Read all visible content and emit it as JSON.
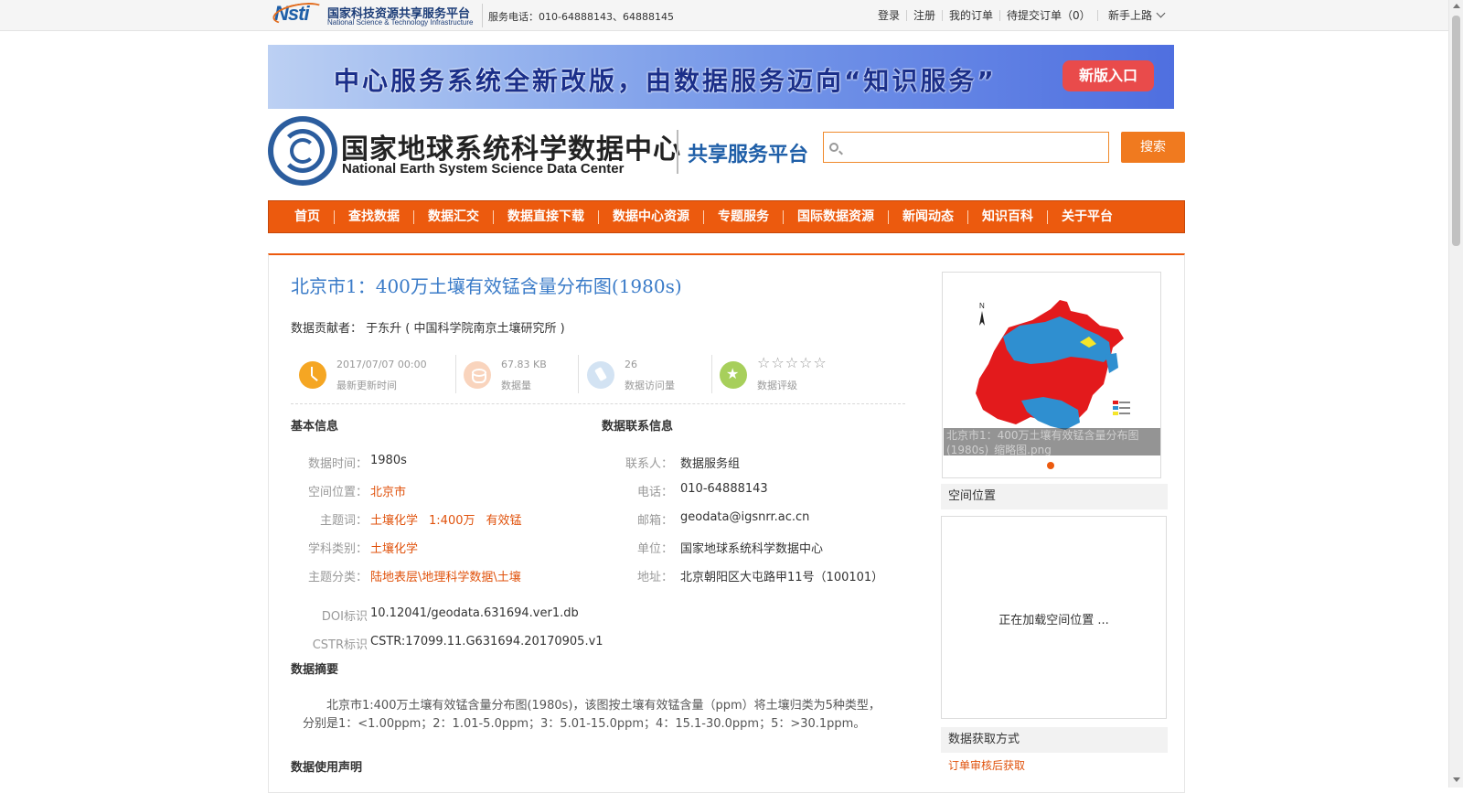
{
  "topbar": {
    "logo_cn": "国家科技资源共享服务平台",
    "logo_en": "National Science & Technology Infrastructure",
    "hotline": "服务电话：010-64888143、64888145",
    "links": [
      "登录",
      "注册",
      "我的订单",
      "待提交订单（0）"
    ],
    "guide": "新手上路"
  },
  "banner": {
    "text": "中心服务系统全新改版，由数据服务迈向“知识服务”",
    "button": "新版入口"
  },
  "header": {
    "title_cn": "国家地球系统科学数据中心",
    "title_en": "National Earth System Science Data Center",
    "platform": "共享服务平台",
    "search_placeholder": "",
    "search_button": "搜索"
  },
  "nav": [
    "首页",
    "查找数据",
    "数据汇交",
    "数据直接下载",
    "数据中心资源",
    "专题服务",
    "国际数据资源",
    "新闻动态",
    "知识百科",
    "关于平台"
  ],
  "dataset": {
    "title": "北京市1：400万土壤有效锰含量分布图(1980s)",
    "contributor_label": "数据贡献者：",
    "contributor": "于东升 ( 中国科学院南京土壤研究所 )",
    "stats": [
      {
        "value": "2017/07/07 00:00",
        "label": "最新更新时间",
        "icon": "clock-icon",
        "color": "#f5a623"
      },
      {
        "value": "67.83 KB",
        "label": "数据量",
        "icon": "database-icon",
        "color": "#f9d4bd"
      },
      {
        "value": "26",
        "label": "数据访问量",
        "icon": "visit-icon",
        "color": "#d3e3f3"
      },
      {
        "value": "☆☆☆☆☆",
        "label": "数据评级",
        "icon": "star-icon",
        "color": "#a7cf5b"
      }
    ],
    "basic_title": "基本信息",
    "basic": {
      "time_label": "数据时间：",
      "time": "1980s",
      "space_label": "空间位置：",
      "space": "北京市",
      "keywords_label": "主题词：",
      "keywords": [
        "土壤化学",
        "1:400万",
        "有效锰"
      ],
      "discipline_label": "学科类别：",
      "discipline": "土壤化学",
      "category_label": "主题分类：",
      "category": "陆地表层\\地理科学数据\\土壤",
      "doi_label": "DOI标识",
      "doi": "10.12041/geodata.631694.ver1.db",
      "cstr_label": "CSTR标识",
      "cstr": "CSTR:17099.11.G631694.20170905.v1"
    },
    "contact_title": "数据联系信息",
    "contact": {
      "person_label": "联系人：",
      "person": "数据服务组",
      "phone_label": "电话：",
      "phone": "010-64888143",
      "email_label": "邮箱：",
      "email": "geodata@igsnrr.ac.cn",
      "org_label": "单位：",
      "org": "国家地球系统科学数据中心",
      "address_label": "地址：",
      "address": "北京朝阳区大屯路甲11号（100101）"
    },
    "abstract_title": "数据摘要",
    "abstract": "北京市1:400万土壤有效锰含量分布图(1980s)，该图按土壤有效锰含量（ppm）将土壤归类为5种类型，分别是1：<1.00ppm；2：1.01-5.0ppm；3：5.01-15.0ppm；4：15.1-30.0ppm；5：>30.1ppm。",
    "usage_title": "数据使用声明"
  },
  "sidebar": {
    "thumb_caption": "北京市1：400万土壤有效锰含量分布图(1980s)_缩略图.png",
    "space_title": "空间位置",
    "space_loading": "正在加载空间位置 ...",
    "access_title": "数据获取方式",
    "access_method": "订单审核后获取"
  },
  "colors": {
    "accent": "#ec5a0e",
    "title_blue": "#3a7bc8",
    "map_red": "#e31a1c",
    "map_blue": "#2f8fd0",
    "map_yellow": "#f5e52a"
  }
}
